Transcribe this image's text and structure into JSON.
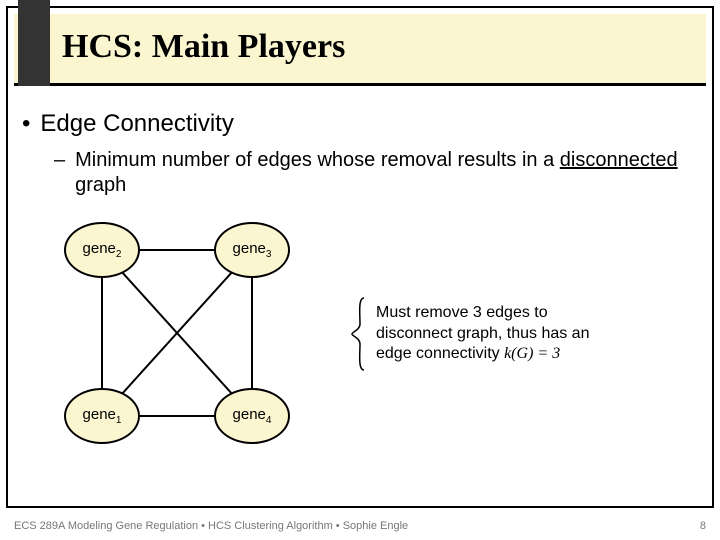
{
  "header": {
    "title": "HCS: Main Players"
  },
  "bullets": {
    "l1": "Edge Connectivity",
    "l2_pre": "Minimum number of edges whose removal results in a ",
    "l2_underlined": "disconnected",
    "l2_post": " graph"
  },
  "nodes": {
    "n1_base": "gene",
    "n1_sub": "1",
    "n2_base": "gene",
    "n2_sub": "2",
    "n3_base": "gene",
    "n3_sub": "3",
    "n4_base": "gene",
    "n4_sub": "4"
  },
  "annotation": {
    "line1": "Must remove 3 edges to",
    "line2": "disconnect graph, thus has an",
    "line3_pre": "edge connectivity ",
    "line3_expr": "k(G) = 3"
  },
  "footer": {
    "left": "ECS 289A Modeling Gene Regulation • HCS Clustering Algorithm • Sophie Engle",
    "pagenum": "8"
  }
}
